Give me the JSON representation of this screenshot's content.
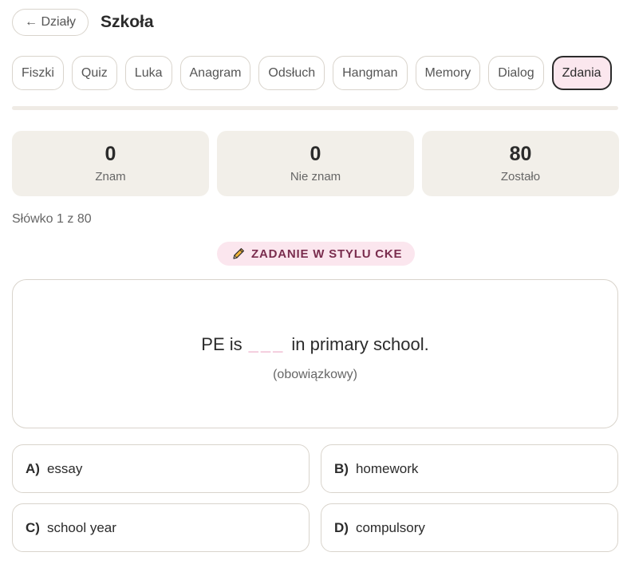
{
  "header": {
    "back_label": "← Działy",
    "title": "Szkoła"
  },
  "tabs": [
    {
      "label": "Fiszki",
      "active": false
    },
    {
      "label": "Quiz",
      "active": false
    },
    {
      "label": "Luka",
      "active": false
    },
    {
      "label": "Anagram",
      "active": false
    },
    {
      "label": "Odsłuch",
      "active": false
    },
    {
      "label": "Hangman",
      "active": false
    },
    {
      "label": "Memory",
      "active": false
    },
    {
      "label": "Dialog",
      "active": false
    },
    {
      "label": "Zdania",
      "active": true
    }
  ],
  "progress": {
    "fraction": 0.0
  },
  "stats": [
    {
      "value": "0",
      "label": "Znam"
    },
    {
      "value": "0",
      "label": "Nie znam"
    },
    {
      "value": "80",
      "label": "Zostało"
    }
  ],
  "counter": "Słówko 1 z 80",
  "badge": {
    "icon": "pencil-icon",
    "label": "ZADANIE W STYLU CKE"
  },
  "question": {
    "before": "PE is",
    "blank": "___",
    "after": "in primary school.",
    "hint": "(obowiązkowy)"
  },
  "options": [
    {
      "letter": "A)",
      "text": "essay"
    },
    {
      "letter": "B)",
      "text": "homework"
    },
    {
      "letter": "C)",
      "text": "school year"
    },
    {
      "letter": "D)",
      "text": "compulsory"
    }
  ],
  "colors": {
    "accent": "#e27aa3",
    "active_tab_bg": "#fbe7ee",
    "stat_bg": "#f2efe9",
    "badge_text": "#7a2d4e"
  }
}
